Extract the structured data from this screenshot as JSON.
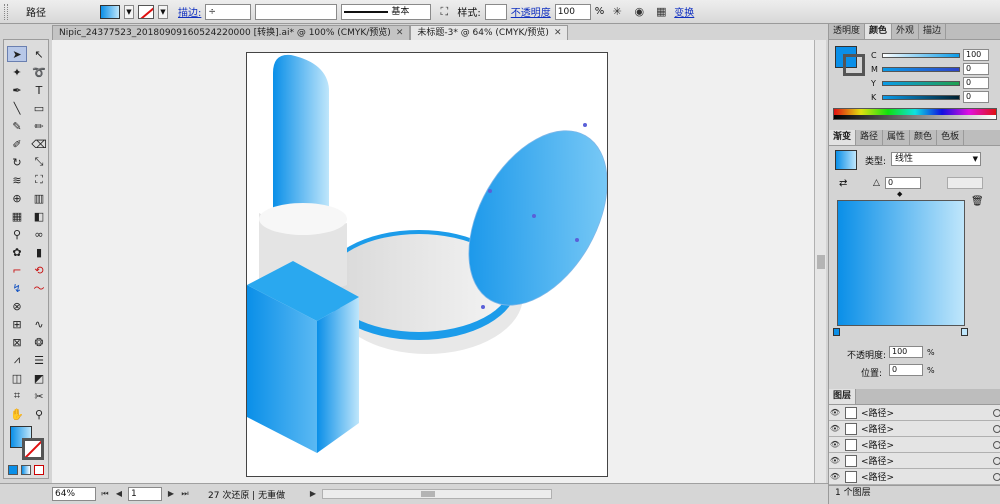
{
  "control_bar": {
    "selection_type": "路径",
    "stroke_label": "描边:",
    "brush_label": "基本",
    "style_label": "样式:",
    "opacity_label": "不透明度",
    "opacity_value": "100",
    "opacity_unit": "%",
    "transform_label": "变换"
  },
  "tabs": [
    {
      "label": "Nipic_24377523_20180909160524220000 [转换].ai* @ 100% (CMYK/预览)",
      "active": false
    },
    {
      "label": "未标题-3* @ 64% (CMYK/预览)",
      "active": true
    }
  ],
  "panels": {
    "color": {
      "tabs": [
        "透明度",
        "颜色",
        "外观",
        "描边"
      ],
      "channels": [
        {
          "name": "C",
          "value": "100"
        },
        {
          "name": "M",
          "value": "0"
        },
        {
          "name": "Y",
          "value": "0"
        },
        {
          "name": "K",
          "value": "0"
        }
      ]
    },
    "gradient": {
      "tabs": [
        "渐变",
        "路径",
        "属性",
        "颜色",
        "色板"
      ],
      "type_label": "类型:",
      "type_value": "线性",
      "angle_value": "0",
      "opacity_label": "不透明度:",
      "opacity_value": "100",
      "location_label": "位置:",
      "location_value": "0",
      "unit": "%"
    },
    "layers": {
      "tab": "图层",
      "rows": [
        "<路径>",
        "<路径>",
        "<路径>",
        "<路径>",
        "<路径>"
      ],
      "footer": "1 个图层"
    }
  },
  "status_bar": {
    "zoom": "64%",
    "page": "1",
    "message": "27 次还原 | 无重做"
  },
  "colors": {
    "accent_blue": "#0a8fe8",
    "light_blue": "#bfe6fb"
  }
}
